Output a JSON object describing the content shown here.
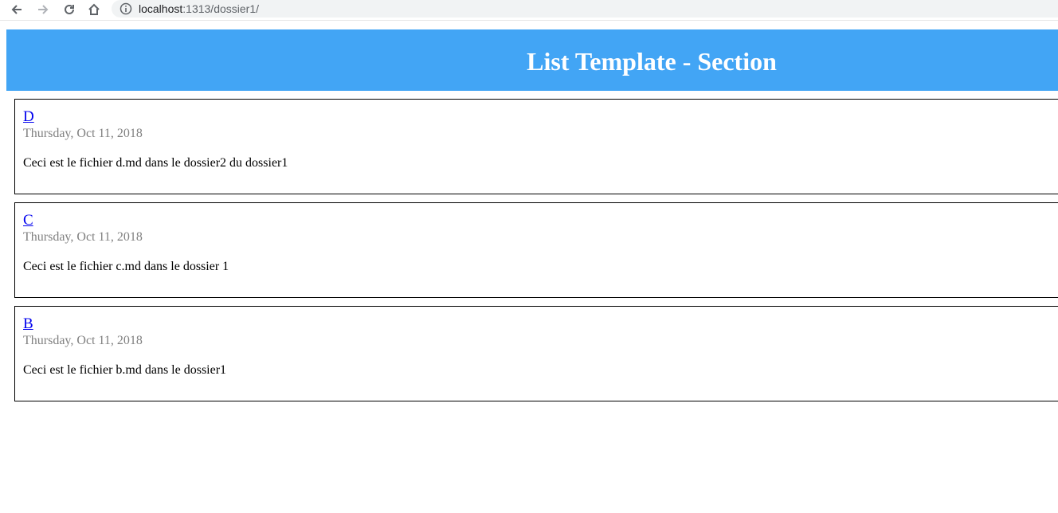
{
  "browser": {
    "url_host": "localhost",
    "url_path": ":1313/dossier1/"
  },
  "header": {
    "title": "List Template - Section",
    "background": "#42a5f5"
  },
  "posts": [
    {
      "title": "D",
      "date": "Thursday, Oct 11, 2018",
      "summary": "Ceci est le fichier d.md dans le dossier2 du dossier1"
    },
    {
      "title": "C",
      "date": "Thursday, Oct 11, 2018",
      "summary": "Ceci est le fichier c.md dans le dossier 1"
    },
    {
      "title": "B",
      "date": "Thursday, Oct 11, 2018",
      "summary": "Ceci est le fichier b.md dans le dossier1"
    }
  ]
}
